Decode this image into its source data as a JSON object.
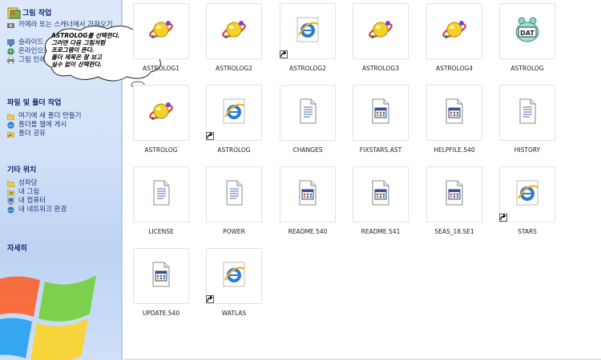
{
  "taskpane": {
    "picture_tasks": {
      "title": "그림 작업",
      "items": [
        "카메라 또는 스캐너에서 가져오기",
        "슬라이드 쇼로 보기",
        "온라인으로 인화 주문",
        "그림 인쇄"
      ]
    },
    "file_folder_tasks": {
      "title": "파일 및 폴더 작업",
      "items": [
        "여기에 새 폴더 만들기",
        "폴더를 웹에 게시",
        "폴더 공유"
      ]
    },
    "other_places": {
      "title": "기타 위치",
      "items": [
        "성좌당",
        "내 그림",
        "내 컴퓨터",
        "내 네트워크 환경"
      ]
    },
    "details": {
      "title": "자세히"
    }
  },
  "callout": {
    "text": "ASTROLOG를 선택한다.\n그러면 다음 그림처럼\n프로그램이 뜬다.\n폴더 제목은 잘 보고\n실수 없이 선택한다."
  },
  "files": [
    {
      "label": "ASTROLOG1",
      "icon": "planet-icon",
      "shortcut": false
    },
    {
      "label": "ASTROLOG2",
      "icon": "planet-icon",
      "shortcut": false
    },
    {
      "label": "ASTROLOG2",
      "icon": "ie-icon",
      "shortcut": true
    },
    {
      "label": "ASTROLOG3",
      "icon": "planet-icon",
      "shortcut": false
    },
    {
      "label": "ASTROLOG4",
      "icon": "planet-icon",
      "shortcut": false
    },
    {
      "label": "ASTROLOG",
      "icon": "dat-file-icon",
      "shortcut": false
    },
    {
      "label": "ASTROLOG",
      "icon": "planet-icon",
      "shortcut": false
    },
    {
      "label": "ASTROLOG",
      "icon": "ie-icon",
      "shortcut": true
    },
    {
      "label": "CHANGES",
      "icon": "text-file-icon",
      "shortcut": false
    },
    {
      "label": "FIXSTARS.AST",
      "icon": "generic-file-icon",
      "shortcut": false
    },
    {
      "label": "HELPFILE.540",
      "icon": "generic-file-icon",
      "shortcut": false
    },
    {
      "label": "HISTORY",
      "icon": "text-file-icon",
      "shortcut": false
    },
    {
      "label": "LICENSE",
      "icon": "text-file-icon",
      "shortcut": false
    },
    {
      "label": "POWER",
      "icon": "text-file-icon",
      "shortcut": false
    },
    {
      "label": "README.540",
      "icon": "generic-file-icon",
      "shortcut": false
    },
    {
      "label": "README.541",
      "icon": "generic-file-icon",
      "shortcut": false
    },
    {
      "label": "SEAS_18.SE1",
      "icon": "generic-file-icon",
      "shortcut": false
    },
    {
      "label": "STARS",
      "icon": "ie-icon",
      "shortcut": true
    },
    {
      "label": "UPDATE.540",
      "icon": "generic-file-icon",
      "shortcut": false
    },
    {
      "label": "WATLAS",
      "icon": "ie-icon",
      "shortcut": true
    }
  ],
  "colors": {
    "pane_bg": "#d3e2f8",
    "pane_title": "#0d2b6b",
    "pane_link": "#1f3b79"
  }
}
